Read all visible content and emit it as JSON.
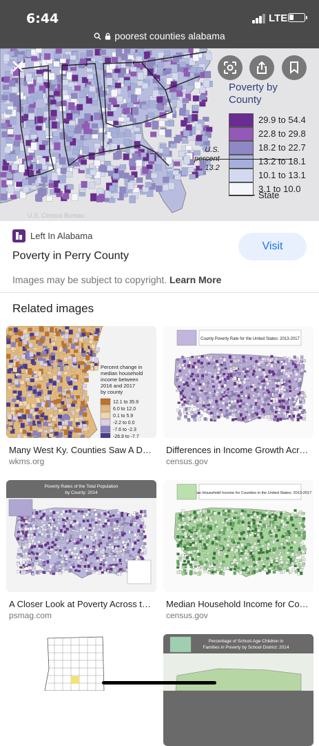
{
  "status": {
    "time": "6:44",
    "network": "LTE"
  },
  "browser": {
    "url": "poorest counties alabama"
  },
  "hero": {
    "legend_title_1": "Poverty by",
    "legend_title_2": "County",
    "legend": [
      {
        "label": "29.9 to 54.4",
        "color": "#6a2c91"
      },
      {
        "label": "22.8 to 29.8",
        "color": "#9359b8"
      },
      {
        "label": "18.2 to 22.7",
        "color": "#8f87c6"
      },
      {
        "label": "13.2 to 18.1",
        "color": "#a6b0dc"
      },
      {
        "label": "10.1 to 13.1",
        "color": "#d3daef"
      },
      {
        "label": "3.1 to 10.0",
        "color": "#f4f6fc"
      }
    ],
    "us_percent_line1": "U.S.",
    "us_percent_line2": "percent",
    "us_percent_value": "13.2",
    "state_label": "State",
    "icons": [
      "close-icon",
      "lens-icon",
      "share-icon",
      "bookmark-icon"
    ]
  },
  "result": {
    "source": "Left In Alabama",
    "title": "Poverty in Perry County",
    "visit_label": "Visit",
    "copyright_text": "Images may be subject to copyright.",
    "learn_more": "Learn More"
  },
  "related": {
    "header": "Related images",
    "items": [
      {
        "title": "Many West Ky. Counties Saw A Decrea…",
        "source": "wkms.org",
        "thumb_legend_title": "Percent change in median household income between 2016 and 2017 by county",
        "thumb_legend": [
          "12.1 to 35.9",
          "6.0 to 12.0",
          "0.1 to 5.9",
          "-2.2 to 0.0",
          "-7.6 to -2.3",
          "-26.9 to -7.7"
        ]
      },
      {
        "title": "Differences in Income Growth Across …",
        "source": "census.gov",
        "thumb_header": "County Poverty Rate for the United States: 2013-2017"
      },
      {
        "title": "A Closer Look at Poverty Across the U…",
        "source": "psmag.com",
        "thumb_header": "Poverty Rates of the Total Population by County: 2014"
      },
      {
        "title": "Median Household Income for Countie…",
        "source": "census.gov",
        "thumb_header": "Median Household Income for Counties in the United States: 2013-2017"
      },
      {
        "title": "",
        "source": ""
      },
      {
        "title": "",
        "source": "",
        "thumb_header": "Percentage of School-Age Children in Families in Poverty by School District: 2014"
      }
    ]
  }
}
